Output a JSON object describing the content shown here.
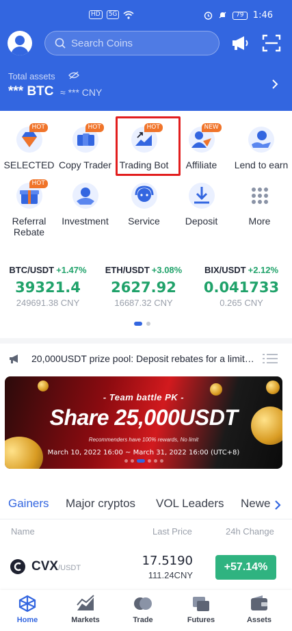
{
  "status_bar": {
    "left_chips": [
      "HD",
      "5G"
    ],
    "battery": "79",
    "time": "1:46"
  },
  "header": {
    "search_placeholder": "Search Coins",
    "total_assets_label": "Total assets",
    "assets_value": "*** BTC",
    "assets_cny": "≈ *** CNY"
  },
  "features": [
    {
      "label": "SELECTED",
      "badge": "HOT",
      "icon": "diamond-icon"
    },
    {
      "label": "Copy Trader",
      "badge": "HOT",
      "icon": "copy-trade-icon"
    },
    {
      "label": "Trading Bot",
      "badge": "HOT",
      "icon": "trading-bot-icon"
    },
    {
      "label": "Affiliate",
      "badge": "NEW",
      "icon": "affiliate-icon"
    },
    {
      "label": "Lend to earn",
      "badge": "",
      "icon": "lend-icon"
    },
    {
      "label": "Referral Rebate",
      "badge": "HOT",
      "icon": "gift-icon"
    },
    {
      "label": "Investment",
      "badge": "",
      "icon": "investment-icon"
    },
    {
      "label": "Service",
      "badge": "",
      "icon": "headset-icon"
    },
    {
      "label": "Deposit",
      "badge": "",
      "icon": "deposit-icon"
    },
    {
      "label": "More",
      "badge": "",
      "icon": "grid-more-icon"
    }
  ],
  "tickers": [
    {
      "pair": "BTC/USDT",
      "change": "+1.47%",
      "price": "39321.4",
      "cny": "249691.38 CNY"
    },
    {
      "pair": "ETH/USDT",
      "change": "+3.08%",
      "price": "2627.92",
      "cny": "16687.32 CNY"
    },
    {
      "pair": "BIX/USDT",
      "change": "+2.12%",
      "price": "0.041733",
      "cny": "0.265 CNY"
    }
  ],
  "announcement": "20,000USDT prize pool: Deposit rebates for a limited...",
  "banner": {
    "line1": "- Team battle PK -",
    "headline": "Share 25,000USDT",
    "line2": "Recommenders have 100% rewards, No limit",
    "dates": "March 10, 2022 16:00 ~ March 31, 2022 16:00 (UTC+8)"
  },
  "market_tabs": [
    "Gainers",
    "Major cryptos",
    "VOL Leaders",
    "Newe"
  ],
  "columns": {
    "name": "Name",
    "last_price": "Last Price",
    "change": "24h Change"
  },
  "rows": [
    {
      "symbol": "CVX",
      "quote": "/USDT",
      "price": "17.5190",
      "cny": "111.24CNY",
      "change": "+57.14%"
    }
  ],
  "bottom_nav": [
    "Home",
    "Markets",
    "Trade",
    "Futures",
    "Assets"
  ],
  "colors": {
    "brand_blue": "#3366e0",
    "up_green": "#20a26a",
    "badge_orange": "#f0742a",
    "highlight_red": "#e21e1e"
  }
}
